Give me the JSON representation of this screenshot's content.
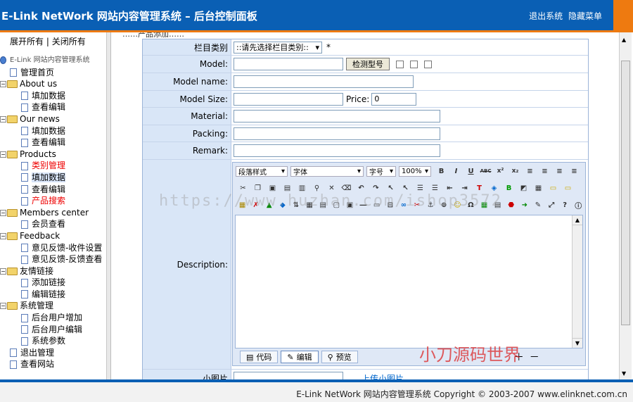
{
  "header": {
    "title": "E-Link NetWork 网站内容管理系统 – 后台控制面板",
    "logout": "退出系统",
    "hide_menu": "隐藏菜单"
  },
  "sidebar": {
    "expand_all": "展开所有",
    "collapse_all": "关闭所有",
    "root": "E-Link 网站内容管理系统",
    "items": [
      {
        "label": "管理首页"
      },
      {
        "label": "About us"
      },
      {
        "label": "填加数据"
      },
      {
        "label": "查看编辑"
      },
      {
        "label": "Our news"
      },
      {
        "label": "填加数据"
      },
      {
        "label": "查看编辑"
      },
      {
        "label": "Products"
      },
      {
        "label": "类别管理"
      },
      {
        "label": "填加数据"
      },
      {
        "label": "查看编辑"
      },
      {
        "label": "产品搜索"
      },
      {
        "label": "Members center"
      },
      {
        "label": "会员查看"
      },
      {
        "label": "Feedback"
      },
      {
        "label": "意见反馈-收件设置"
      },
      {
        "label": "意见反馈-反馈查看"
      },
      {
        "label": "友情链接"
      },
      {
        "label": "添加链接"
      },
      {
        "label": "编辑链接"
      },
      {
        "label": "系统管理"
      },
      {
        "label": "后台用户增加"
      },
      {
        "label": "后台用户编辑"
      },
      {
        "label": "系统参数"
      },
      {
        "label": "退出管理"
      },
      {
        "label": "查看网站"
      }
    ]
  },
  "main": {
    "breadcrumb": "……产品添加……",
    "form": {
      "category_label": "栏目类别",
      "category_value": "::请先选择栏目类别::",
      "required_mark": "*",
      "model_label": "Model:",
      "check_button": "检测型号",
      "model_name_label": "Model name:",
      "model_size_label": "Model Size:",
      "price_label": "Price:",
      "price_value": "0",
      "material_label": "Material:",
      "packing_label": "Packing:",
      "remark_label": "Remark:",
      "description_label": "Description:",
      "small_image_label": "小图片",
      "upload_label": "上传小图片"
    },
    "editor": {
      "paragraph_style": "段落样式",
      "font": "字体",
      "font_size": "字号",
      "zoom": "100%",
      "tab_code": "代码",
      "tab_edit": "编辑",
      "tab_preview": "预览"
    }
  },
  "watermark": {
    "url": "https://www.huzhan.com/ishop3572",
    "brand": "小刀源码世界"
  },
  "footer": {
    "copyright": "E-Link NetWork 网站内容管理系统 Copyright © 2003-2007 www.elinknet.com.cn"
  }
}
